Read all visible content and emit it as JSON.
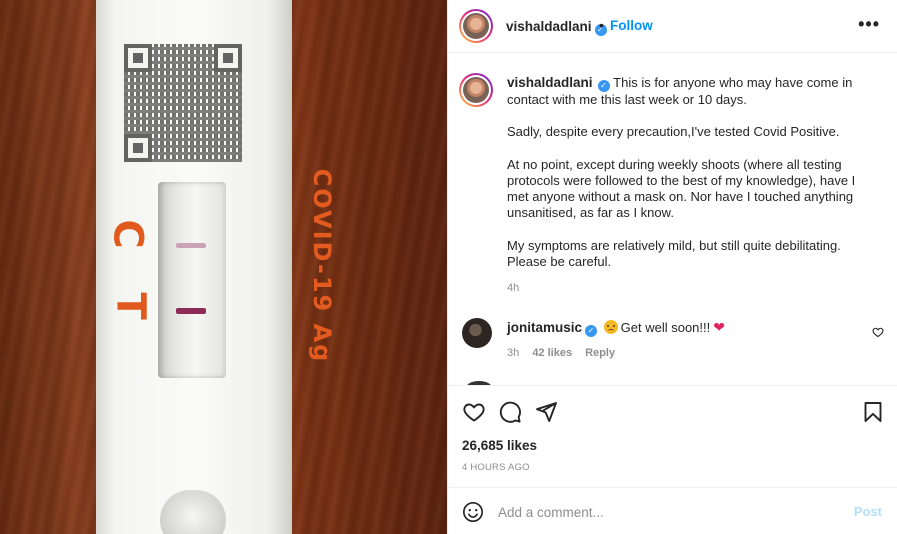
{
  "photo": {
    "marks": {
      "c": "C",
      "t": "T"
    },
    "test_label": "COVID-19 Ag"
  },
  "post": {
    "author": "vishaldadlani",
    "follow_label": "Follow",
    "separator": "•",
    "more_label": "•••",
    "caption": {
      "username": "vishaldadlani",
      "paragraphs": [
        "This is for anyone who may have come in contact with me this last week or 10 days.",
        "Sadly, despite every precaution,I've tested Covid Positive.",
        "At no point, except during weekly shoots (where all testing protocols were followed to the best of my knowledge), have I met anyone without a mask on. Nor have I touched anything unsanitised, as far as I know.",
        "My symptoms are relatively mild, but still quite debilitating. Please be careful."
      ],
      "time": "4h"
    },
    "comments": [
      {
        "username": "jonitamusic",
        "text": "Get well soon!!!",
        "time": "3h",
        "likes": "42 likes",
        "reply_label": "Reply"
      }
    ],
    "likes": "26,685 likes",
    "posted_ago": "4 HOURS AGO",
    "add_comment": {
      "placeholder": "Add a comment...",
      "post_label": "Post"
    }
  },
  "icons": {
    "like": "heart-icon",
    "comment": "comment-icon",
    "share": "send-icon",
    "save": "bookmark-icon",
    "emoji": "smiley-icon",
    "verified": "verified-badge-icon"
  },
  "colors": {
    "accent": "#0095f6",
    "verified": "#3897f0",
    "post_disabled": "#b2dffc",
    "heart": "#e0245e"
  }
}
